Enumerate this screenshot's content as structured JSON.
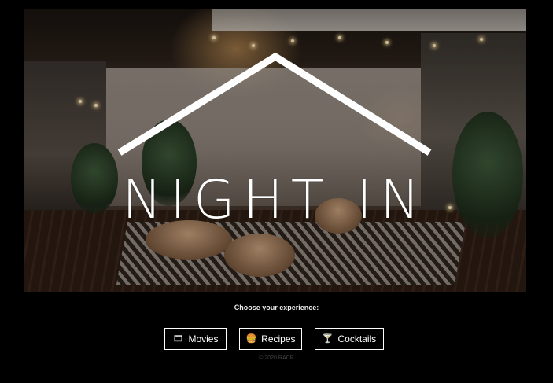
{
  "hero": {
    "logo_text": "NIGHT IN",
    "image_description_icon": "patio-photo"
  },
  "prompt": "Choose your experience:",
  "buttons": [
    {
      "label": "Movies",
      "icon": "film-icon",
      "glyph": "🎞"
    },
    {
      "label": "Recipes",
      "icon": "burger-icon",
      "glyph": "🍔"
    },
    {
      "label": "Cocktails",
      "icon": "cocktail-icon",
      "glyph": "🍸"
    }
  ],
  "footer": "© 2020 RACR",
  "colors": {
    "background": "#000000",
    "text": "#ffffff",
    "footer": "#444444"
  }
}
